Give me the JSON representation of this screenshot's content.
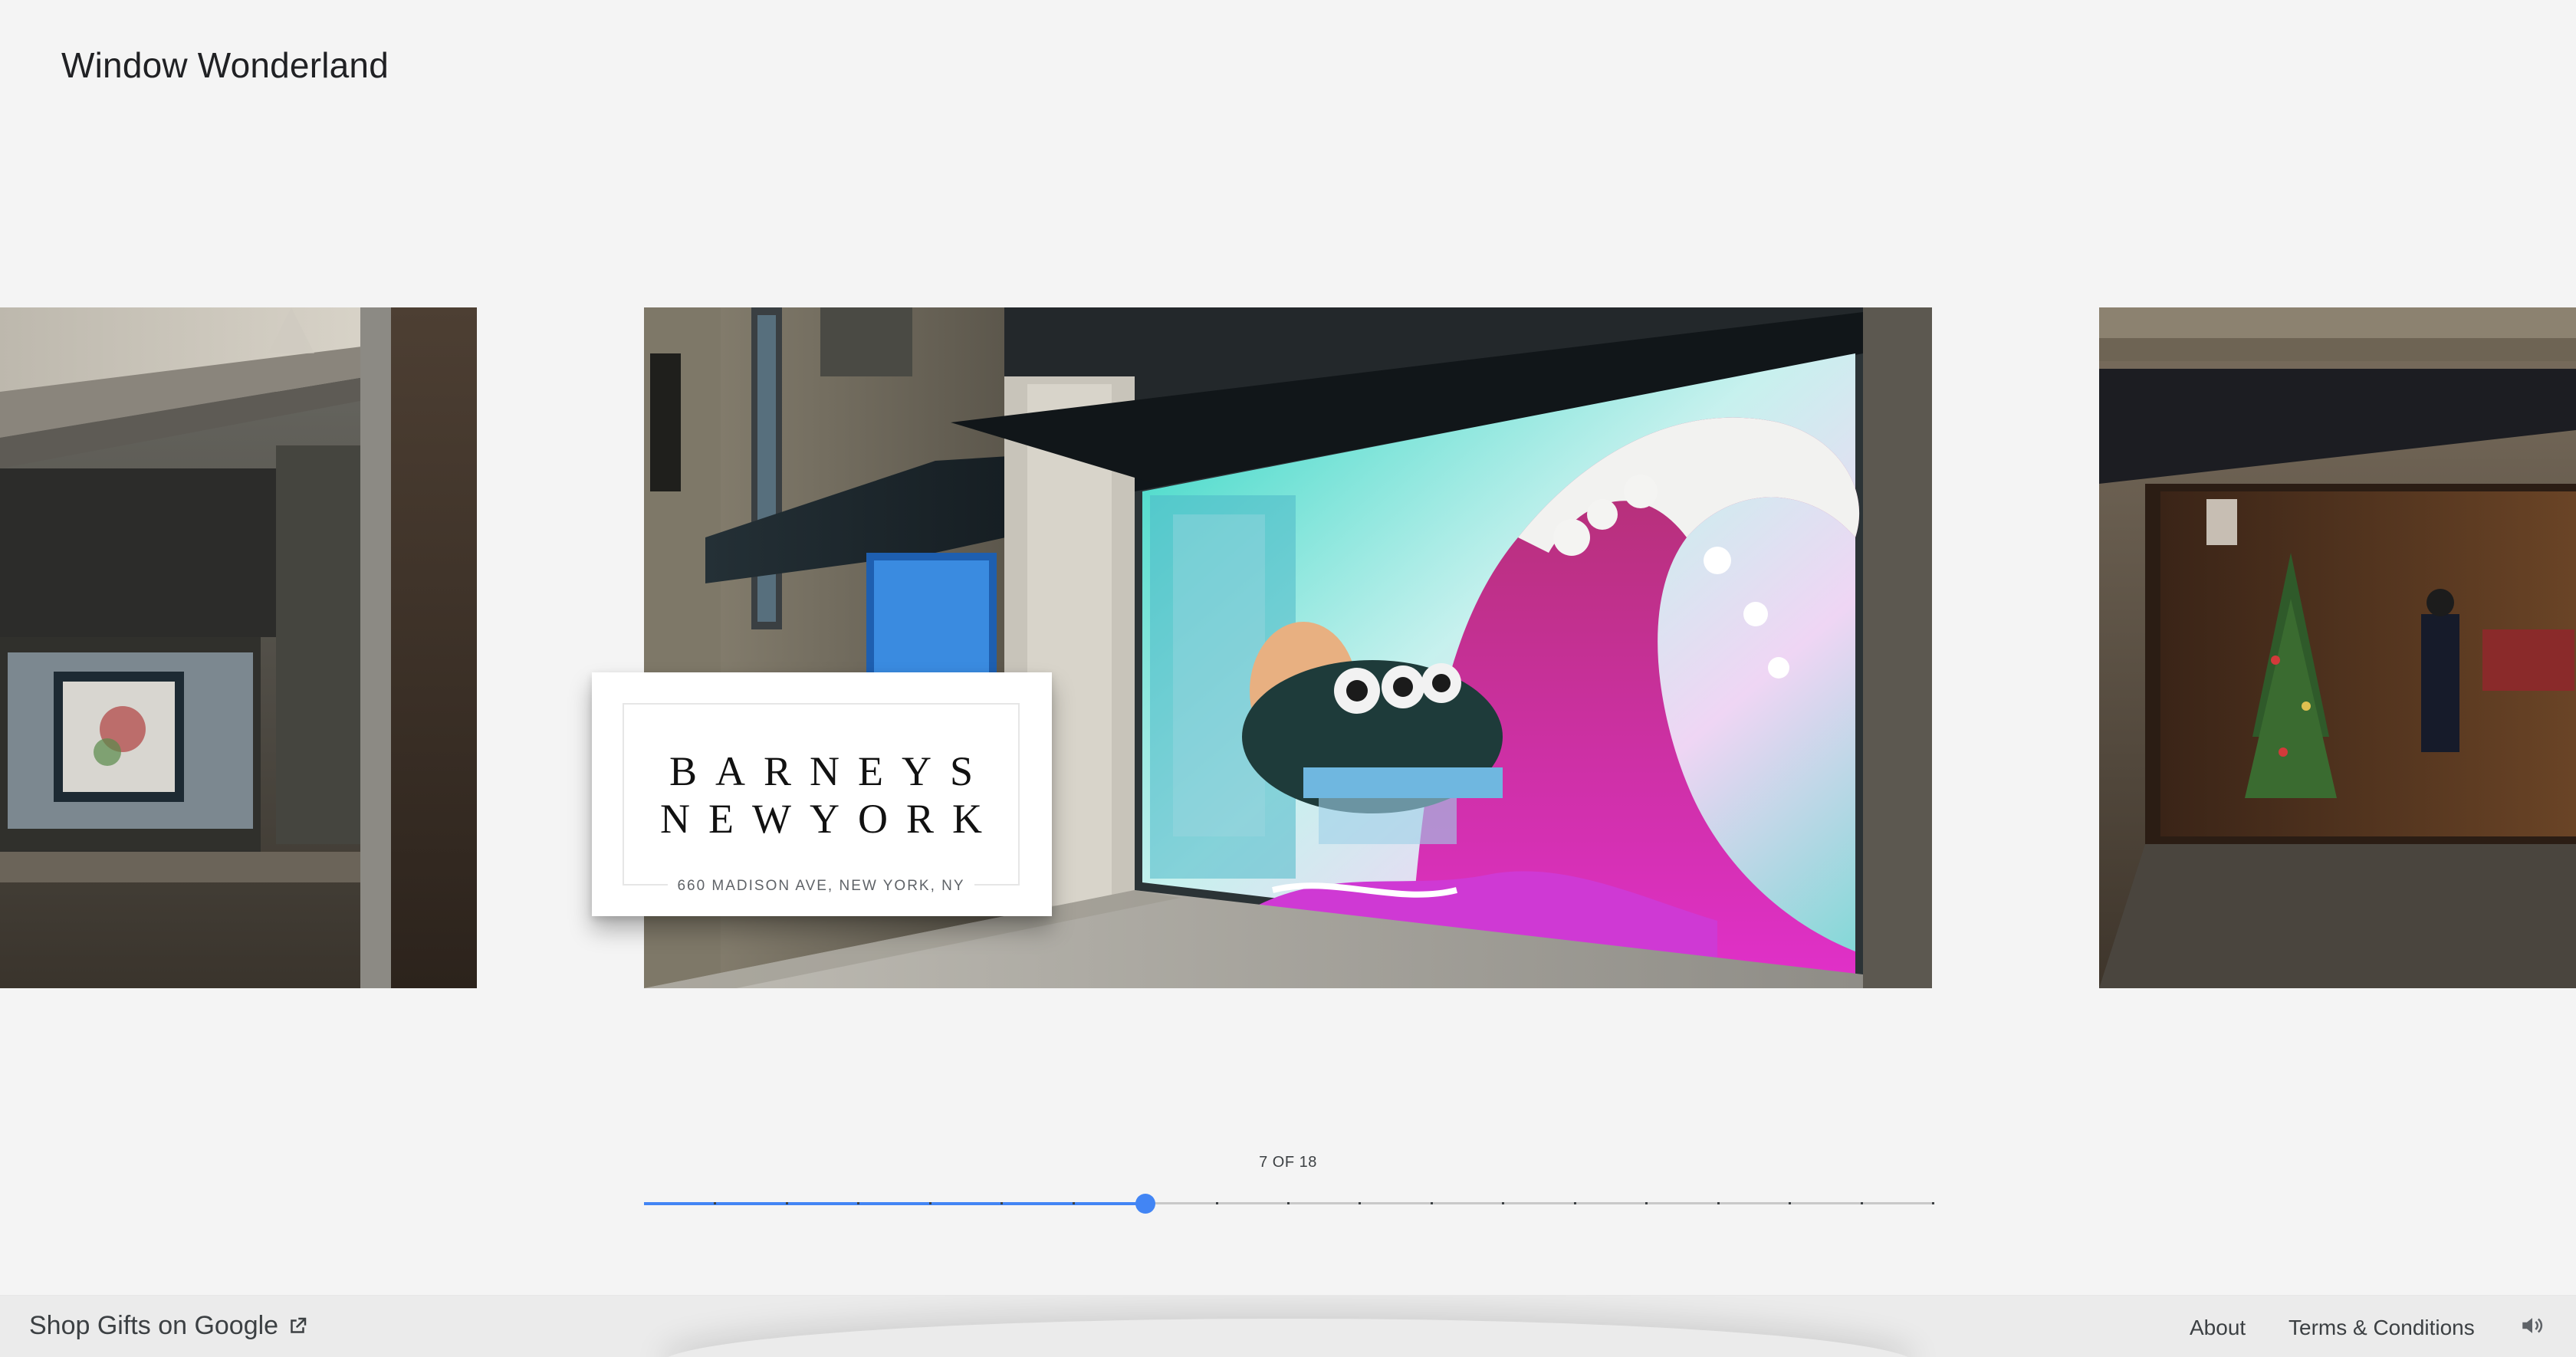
{
  "app": {
    "title": "Window Wonderland"
  },
  "store": {
    "logo_line1": "BARNEYS",
    "logo_line2": "NEWYORK",
    "address": "660 MADISON AVE, NEW YORK, NY"
  },
  "carousel": {
    "counter_label": "7 OF 18",
    "current": 7,
    "total": 18,
    "accent_color": "#4285f4"
  },
  "footer": {
    "shop_label": "Shop Gifts on Google",
    "about_label": "About",
    "terms_label": "Terms & Conditions"
  },
  "icons": {
    "external_link": "external-link-icon",
    "sound": "speaker-icon"
  }
}
